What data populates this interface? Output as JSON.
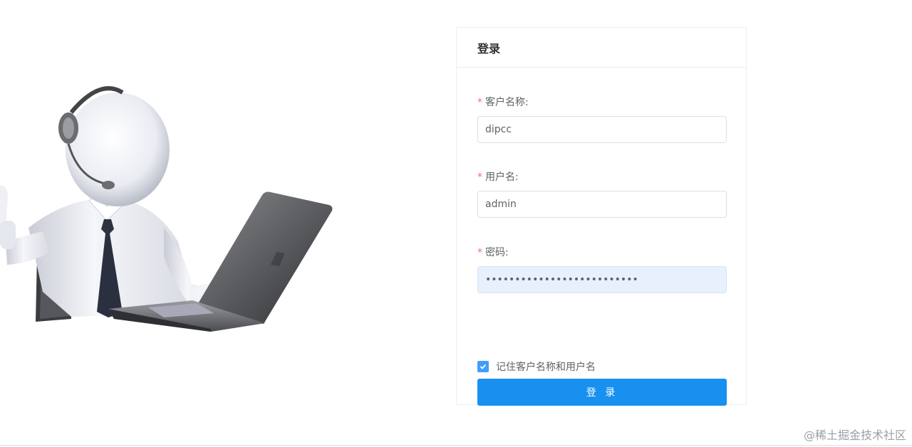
{
  "login_card": {
    "title": "登录",
    "customer_name": {
      "label": "客户名称:",
      "value": "dipcc"
    },
    "username": {
      "label": "用户名:",
      "value": "admin"
    },
    "password": {
      "label": "密码:",
      "value": "••••••••••••••••••••••••••"
    },
    "remember": {
      "label": "记住客户名称和用户名",
      "checked": true
    },
    "submit_label": "登 录",
    "required_mark": "*"
  },
  "watermark": "@稀土掘金技术社区",
  "colors": {
    "primary": "#1890f0",
    "checkbox": "#409eff",
    "required": "#f56c6c",
    "autofill_bg": "#e8f0fe"
  },
  "icons": [
    "checkmark-icon"
  ]
}
